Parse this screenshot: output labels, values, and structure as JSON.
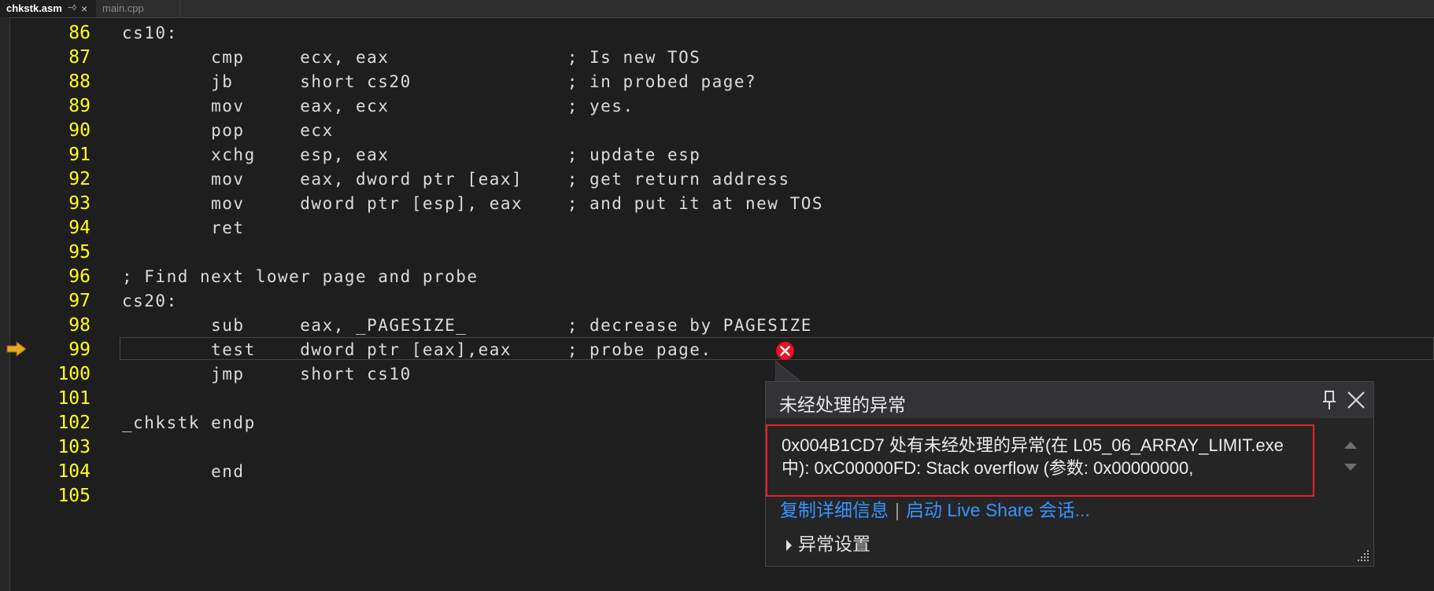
{
  "tabs": [
    {
      "label": "chkstk.asm",
      "active": true,
      "pin_icon": "pin-icon",
      "close_icon": "close-icon"
    },
    {
      "label": "main.cpp",
      "active": false
    }
  ],
  "editor": {
    "current_line": 99,
    "lines": [
      {
        "num": "86",
        "text": "cs10:"
      },
      {
        "num": "87",
        "text": "        cmp     ecx, eax                ; Is new TOS"
      },
      {
        "num": "88",
        "text": "        jb      short cs20              ; in probed page?"
      },
      {
        "num": "89",
        "text": "        mov     eax, ecx                ; yes."
      },
      {
        "num": "90",
        "text": "        pop     ecx"
      },
      {
        "num": "91",
        "text": "        xchg    esp, eax                ; update esp"
      },
      {
        "num": "92",
        "text": "        mov     eax, dword ptr [eax]    ; get return address"
      },
      {
        "num": "93",
        "text": "        mov     dword ptr [esp], eax    ; and put it at new TOS"
      },
      {
        "num": "94",
        "text": "        ret"
      },
      {
        "num": "95",
        "text": ""
      },
      {
        "num": "96",
        "text": "; Find next lower page and probe"
      },
      {
        "num": "97",
        "text": "cs20:"
      },
      {
        "num": "98",
        "text": "        sub     eax, _PAGESIZE_         ; decrease by PAGESIZE"
      },
      {
        "num": "99",
        "text": "        test    dword ptr [eax],eax     ; probe page."
      },
      {
        "num": "100",
        "text": "        jmp     short cs10"
      },
      {
        "num": "101",
        "text": ""
      },
      {
        "num": "102",
        "text": "_chkstk endp"
      },
      {
        "num": "103",
        "text": ""
      },
      {
        "num": "104",
        "text": "        end"
      },
      {
        "num": "105",
        "text": ""
      }
    ]
  },
  "exception_popup": {
    "title": "未经处理的异常",
    "message": "0x004B1CD7 处有未经处理的异常(在 L05_06_ARRAY_LIMIT.exe 中): 0xC00000FD: Stack overflow (参数: 0x00000000,",
    "link_copy": "复制详细信息",
    "link_separator": "|",
    "link_liveshare": "启动 Live Share 会话...",
    "settings_label": "异常设置"
  },
  "colors": {
    "editor_bg": "#1e1e1e",
    "line_number": "#ffff1c",
    "code_text": "#dcdcdc",
    "link": "#3794ff",
    "error_border": "#e6212a",
    "error_icon": "#e81123",
    "exec_arrow": "#e8a628"
  },
  "icons": {
    "execution": "execution-pointer-arrow-icon",
    "error": "error-circle-x-icon",
    "popup_pin": "pin-icon",
    "popup_close": "close-icon",
    "settings_expand": "chevron-right-icon",
    "resize": "resize-grip-icon"
  }
}
